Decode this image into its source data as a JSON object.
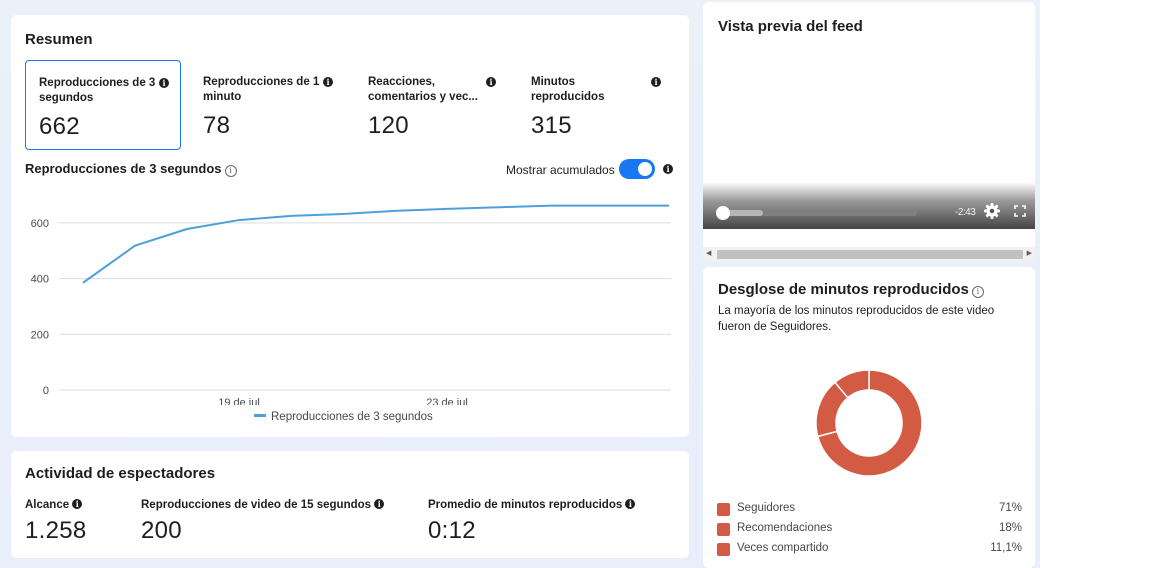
{
  "resumen": {
    "title": "Resumen",
    "metrics": [
      {
        "label": "Reproducciones de 3 segundos",
        "value": "662"
      },
      {
        "label": "Reproducciones de 1 minuto",
        "value": "78"
      },
      {
        "label": "Reacciones, comentarios y vec...",
        "value": "120"
      },
      {
        "label": "Minutos reproducidos",
        "value": "315"
      }
    ],
    "chart_title": "Reproducciones de 3 segundos",
    "toggle_label": "Mostrar acumulados",
    "toggle_on": true
  },
  "chart_data": {
    "type": "line",
    "x": [
      "16 de jul",
      "17 de jul",
      "18 de jul",
      "19 de jul",
      "20 de jul",
      "21 de jul",
      "22 de jul",
      "23 de jul",
      "24 de jul",
      "25 de jul",
      "26 de jul"
    ],
    "x_tick_labels": [
      "19 de jul",
      "23 de jul"
    ],
    "y_ticks": [
      "0",
      "200",
      "400",
      "600"
    ],
    "ylim": [
      0,
      700
    ],
    "series": [
      {
        "name": "Reproducciones de 3 segundos",
        "color": "#4ea0d9",
        "values": [
          385,
          518,
          578,
          610,
          625,
          632,
          643,
          650,
          656,
          662,
          662
        ]
      }
    ],
    "legend_position": "bottom",
    "grid": true
  },
  "actividad": {
    "title": "Actividad de espectadores",
    "metrics": [
      {
        "label": "Alcance",
        "value": "1.258"
      },
      {
        "label": "Reproducciones de video de 15 segundos",
        "value": "200"
      },
      {
        "label": "Promedio de minutos reproducidos",
        "value": "0:12"
      }
    ]
  },
  "preview": {
    "title": "Vista previa del feed",
    "time_remaining": "-2:43",
    "progress_fraction": 0.22,
    "icons": [
      "gear-icon",
      "fullscreen-icon"
    ]
  },
  "desglose": {
    "title": "Desglose de minutos reproducidos",
    "description": "La mayoría de los minutos reproducidos de este video fueron de Seguidores.",
    "donut_color": "#d35b44",
    "segments": [
      {
        "label": "Seguidores",
        "value": 71,
        "display": "71%"
      },
      {
        "label": "Recomendaciones",
        "value": 18,
        "display": "18%"
      },
      {
        "label": "Veces compartido",
        "value": 11.1,
        "display": "11,1%"
      }
    ]
  }
}
